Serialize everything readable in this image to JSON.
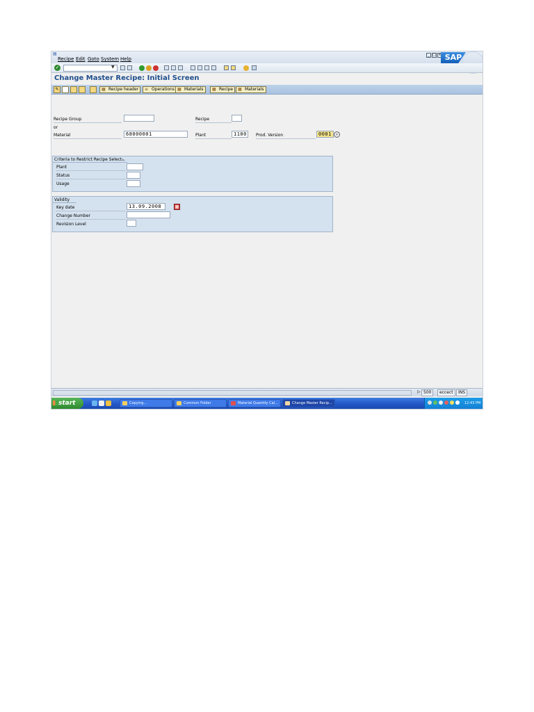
{
  "menu": {
    "items": [
      "Recipe",
      "Edit",
      "Goto",
      "System",
      "Help"
    ]
  },
  "title": "Change Master Recipe: Initial Screen",
  "app_toolbar": {
    "recipe_header": "Recipe header",
    "operations": "Operations",
    "materials_1": "Materials",
    "recipe": "Recipe",
    "materials_2": "Materials"
  },
  "form": {
    "recipe_group_label": "Recipe Group",
    "or_label": "or",
    "material_label": "Material",
    "material_value": "68000001",
    "recipe_label": "Recipe",
    "plant_label": "Plant",
    "plant_value": "1100",
    "prod_version_label": "Prod. Version",
    "prod_version_value": "0001"
  },
  "criteria": {
    "title": "Criteria to Restrict Recipe Selection",
    "plant_label": "Plant",
    "status_label": "Status",
    "usage_label": "Usage"
  },
  "validity": {
    "title": "Validity",
    "key_date_label": "Key date",
    "key_date_value": "13.09.2008",
    "change_number_label": "Change Number",
    "revision_level_label": "Revision Level"
  },
  "statusbar": {
    "client": "500",
    "server": "eccect",
    "mode": "INS"
  },
  "taskbar": {
    "start": "start",
    "tasks": [
      "Copying...",
      "Common Folder",
      "Material Quantity Cal...",
      "Change Master Recip..."
    ],
    "clock": "12:43 PM"
  }
}
